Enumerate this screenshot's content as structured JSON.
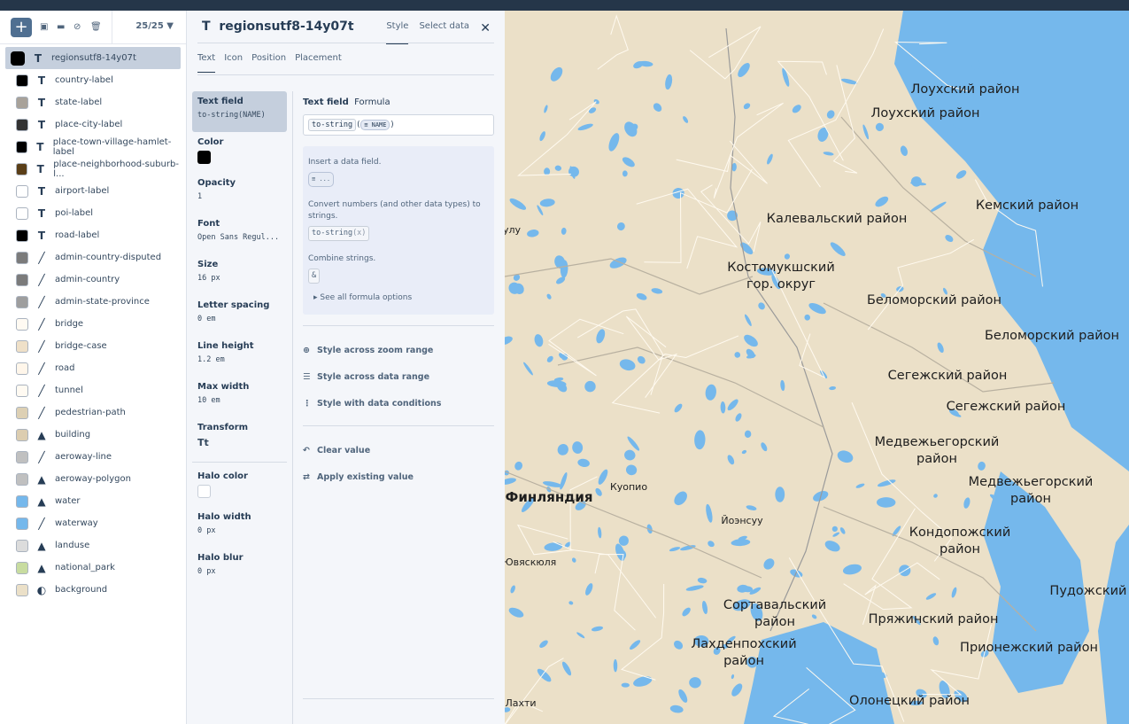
{
  "layers_panel": {
    "count": "25/25",
    "layers": [
      {
        "name": "regionsutf8-14y07t",
        "type": "symbol",
        "color": "#000000",
        "selected": true
      },
      {
        "name": "country-label",
        "type": "symbol",
        "color": "#000000"
      },
      {
        "name": "state-label",
        "type": "symbol",
        "color": "#a8a29a"
      },
      {
        "name": "place-city-label",
        "type": "symbol",
        "color": "#333333"
      },
      {
        "name": "place-town-village-hamlet-label",
        "type": "symbol",
        "color": "#000000"
      },
      {
        "name": "place-neighborhood-suburb-l...",
        "type": "symbol",
        "color": "#5a3e17"
      },
      {
        "name": "airport-label",
        "type": "symbol-icon",
        "color": "#ffffff"
      },
      {
        "name": "poi-label",
        "type": "symbol-icon",
        "color": "#ffffff"
      },
      {
        "name": "road-label",
        "type": "symbol",
        "color": "#000000"
      },
      {
        "name": "admin-country-disputed",
        "type": "line",
        "color": "#7b7b7b"
      },
      {
        "name": "admin-country",
        "type": "line",
        "color": "#7b7b7b"
      },
      {
        "name": "admin-state-province",
        "type": "line",
        "color": "#9e9e9e"
      },
      {
        "name": "bridge",
        "type": "line",
        "color": "#fffaf2"
      },
      {
        "name": "bridge-case",
        "type": "line",
        "color": "#efe0c8"
      },
      {
        "name": "road",
        "type": "line",
        "color": "#fff6ea"
      },
      {
        "name": "tunnel",
        "type": "line",
        "color": "#fffaf2"
      },
      {
        "name": "pedestrian-path",
        "type": "line",
        "color": "#ddd0b4"
      },
      {
        "name": "building",
        "type": "fill",
        "color": "#dccdb0"
      },
      {
        "name": "aeroway-line",
        "type": "line",
        "color": "#c0c0c0"
      },
      {
        "name": "aeroway-polygon",
        "type": "fill",
        "color": "#c0c0c0"
      },
      {
        "name": "water",
        "type": "fill",
        "color": "#75b8ec"
      },
      {
        "name": "waterway",
        "type": "line",
        "color": "#75b8ec"
      },
      {
        "name": "landuse",
        "type": "fill",
        "color": "#dcdcdc"
      },
      {
        "name": "national_park",
        "type": "fill",
        "color": "#c8dca0"
      },
      {
        "name": "background",
        "type": "background",
        "color": "#ebe0c8"
      }
    ]
  },
  "editor": {
    "title": "regionsutf8-14y07t",
    "tabs": [
      "Style",
      "Select data"
    ],
    "subtabs": [
      "Text",
      "Icon",
      "Position",
      "Placement"
    ],
    "properties": [
      {
        "label": "Text field",
        "value": "to-string(NAME)"
      },
      {
        "label": "Color",
        "swatch": "#000000"
      },
      {
        "label": "Opacity",
        "value": "1"
      },
      {
        "label": "Font",
        "value": "Open Sans Regul..."
      },
      {
        "label": "Size",
        "value": "16 px"
      },
      {
        "label": "Letter spacing",
        "value": "0 em"
      },
      {
        "label": "Line height",
        "value": "1.2 em"
      },
      {
        "label": "Max width",
        "value": "10 em"
      },
      {
        "label": "Transform",
        "value": "Tt"
      },
      {
        "label": "Halo color",
        "swatch": "#ffffff"
      },
      {
        "label": "Halo width",
        "value": "0 px"
      },
      {
        "label": "Halo blur",
        "value": "0 px"
      }
    ],
    "field_title": "Text field",
    "field_mode": "Formula",
    "expr_fn": "to-string",
    "expr_field": "NAME",
    "help": {
      "insert": "Insert a data field.",
      "insert_chip": "...",
      "convert": "Convert numbers (and other data types) to strings.",
      "convert_chip": "to-string",
      "convert_arg": "(x)",
      "combine": "Combine strings.",
      "combine_chip": "&",
      "see_all": "See all formula options"
    },
    "actions": [
      "Style across zoom range",
      "Style across data range",
      "Style with data conditions"
    ],
    "actions2": [
      "Clear value",
      "Apply existing value"
    ]
  },
  "map": {
    "labels": [
      "Лоухский район",
      "Лоухский район",
      "Кемский район",
      "Калевальский район",
      "Костомукшский\nгор. округ",
      "Беломорский район",
      "Беломорский район",
      "Сегежский район",
      "Сегежский район",
      "Медвежьегорский\nрайон",
      "Медвежьегорский\nрайон",
      "Кондопожский\nрайон",
      "Сортавальский\nрайон",
      "Пряжинский район",
      "Пудожский рай",
      "Прионежский район",
      "Лахденпохский\nрайон",
      "Олонецкий район",
      "Финляндия",
      "Куопио",
      "Йоэнсуу",
      "Ювяскюля",
      "улу",
      "Лахти"
    ],
    "water_color": "#75b8ec",
    "land_color": "#ebe0c8"
  }
}
